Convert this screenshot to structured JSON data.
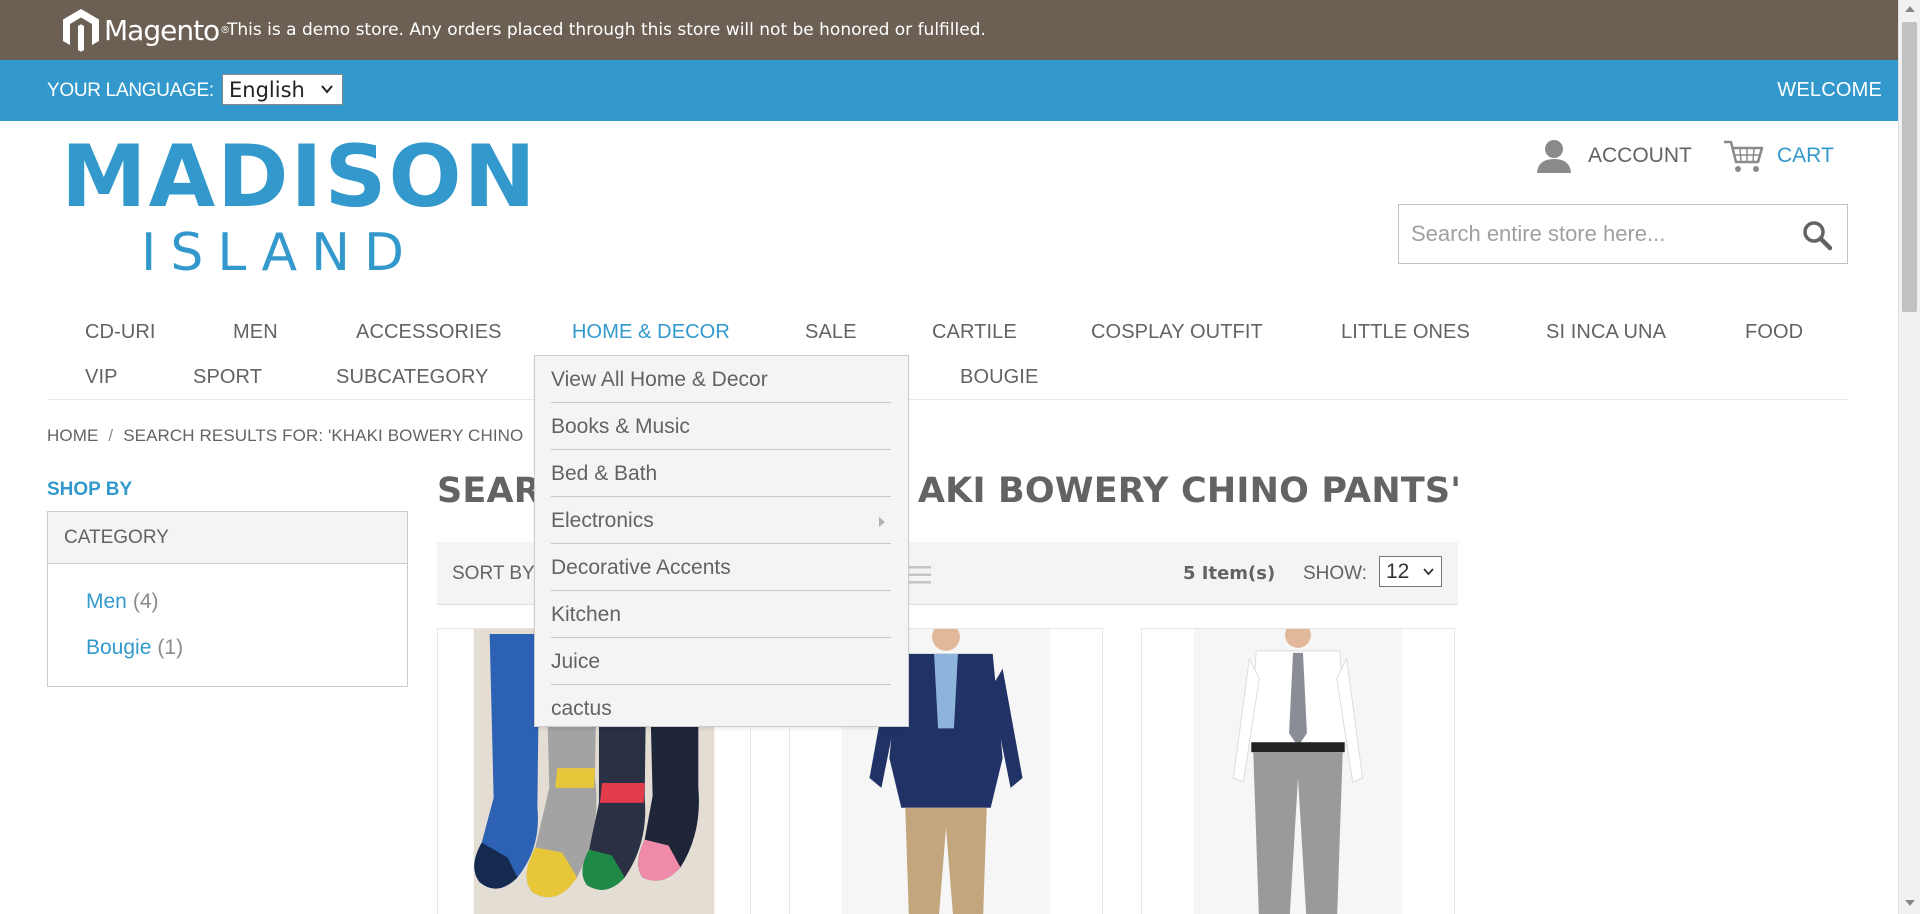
{
  "demo_notice": {
    "brand": "Magento",
    "text": "This is a demo store. Any orders placed through this store will not be honored or fulfilled."
  },
  "top_bar": {
    "language_label": "YOUR LANGUAGE:",
    "language_value": "English",
    "welcome": "WELCOME"
  },
  "header": {
    "logo_line1": "MADISON",
    "logo_line2": "ISLAND",
    "account_label": "ACCOUNT",
    "cart_label": "CART",
    "search_placeholder": "Search entire store here..."
  },
  "nav": {
    "row1": [
      "CD-URI",
      "MEN",
      "ACCESSORIES",
      "HOME & DECOR",
      "SALE",
      "CARTILE",
      "COSPLAY OUTFIT",
      "LITTLE ONES",
      "SI INCA UNA",
      "FOOD"
    ],
    "row2": [
      "VIP",
      "SPORT",
      "SUBCATEGORY",
      "BOUGIE"
    ],
    "active": "HOME & DECOR"
  },
  "dropdown": {
    "items": [
      "View All Home & Decor",
      "Books & Music",
      "Bed & Bath",
      "Electronics",
      "Decorative Accents",
      "Kitchen",
      "Juice",
      "cactus"
    ]
  },
  "breadcrumb": {
    "home": "HOME",
    "separator": "/",
    "current": "SEARCH RESULTS FOR: 'KHAKI BOWERY CHINO"
  },
  "sidebar": {
    "shop_by": "SHOP BY",
    "category_title": "CATEGORY",
    "categories": [
      {
        "name": "Men",
        "count": "(4)"
      },
      {
        "name": "Bougie",
        "count": "(1)"
      }
    ]
  },
  "main": {
    "title_left": "SEARC",
    "title_right": "AKI BOWERY CHINO PANTS'",
    "sort_by": "SORT BY",
    "item_count": "5 Item(s)",
    "show_label": "SHOW:",
    "show_value": "12"
  },
  "colors": {
    "demo_bar": "#6b6053",
    "accent": "#3399cc",
    "text": "#636363",
    "panel": "#f4f4f4"
  }
}
